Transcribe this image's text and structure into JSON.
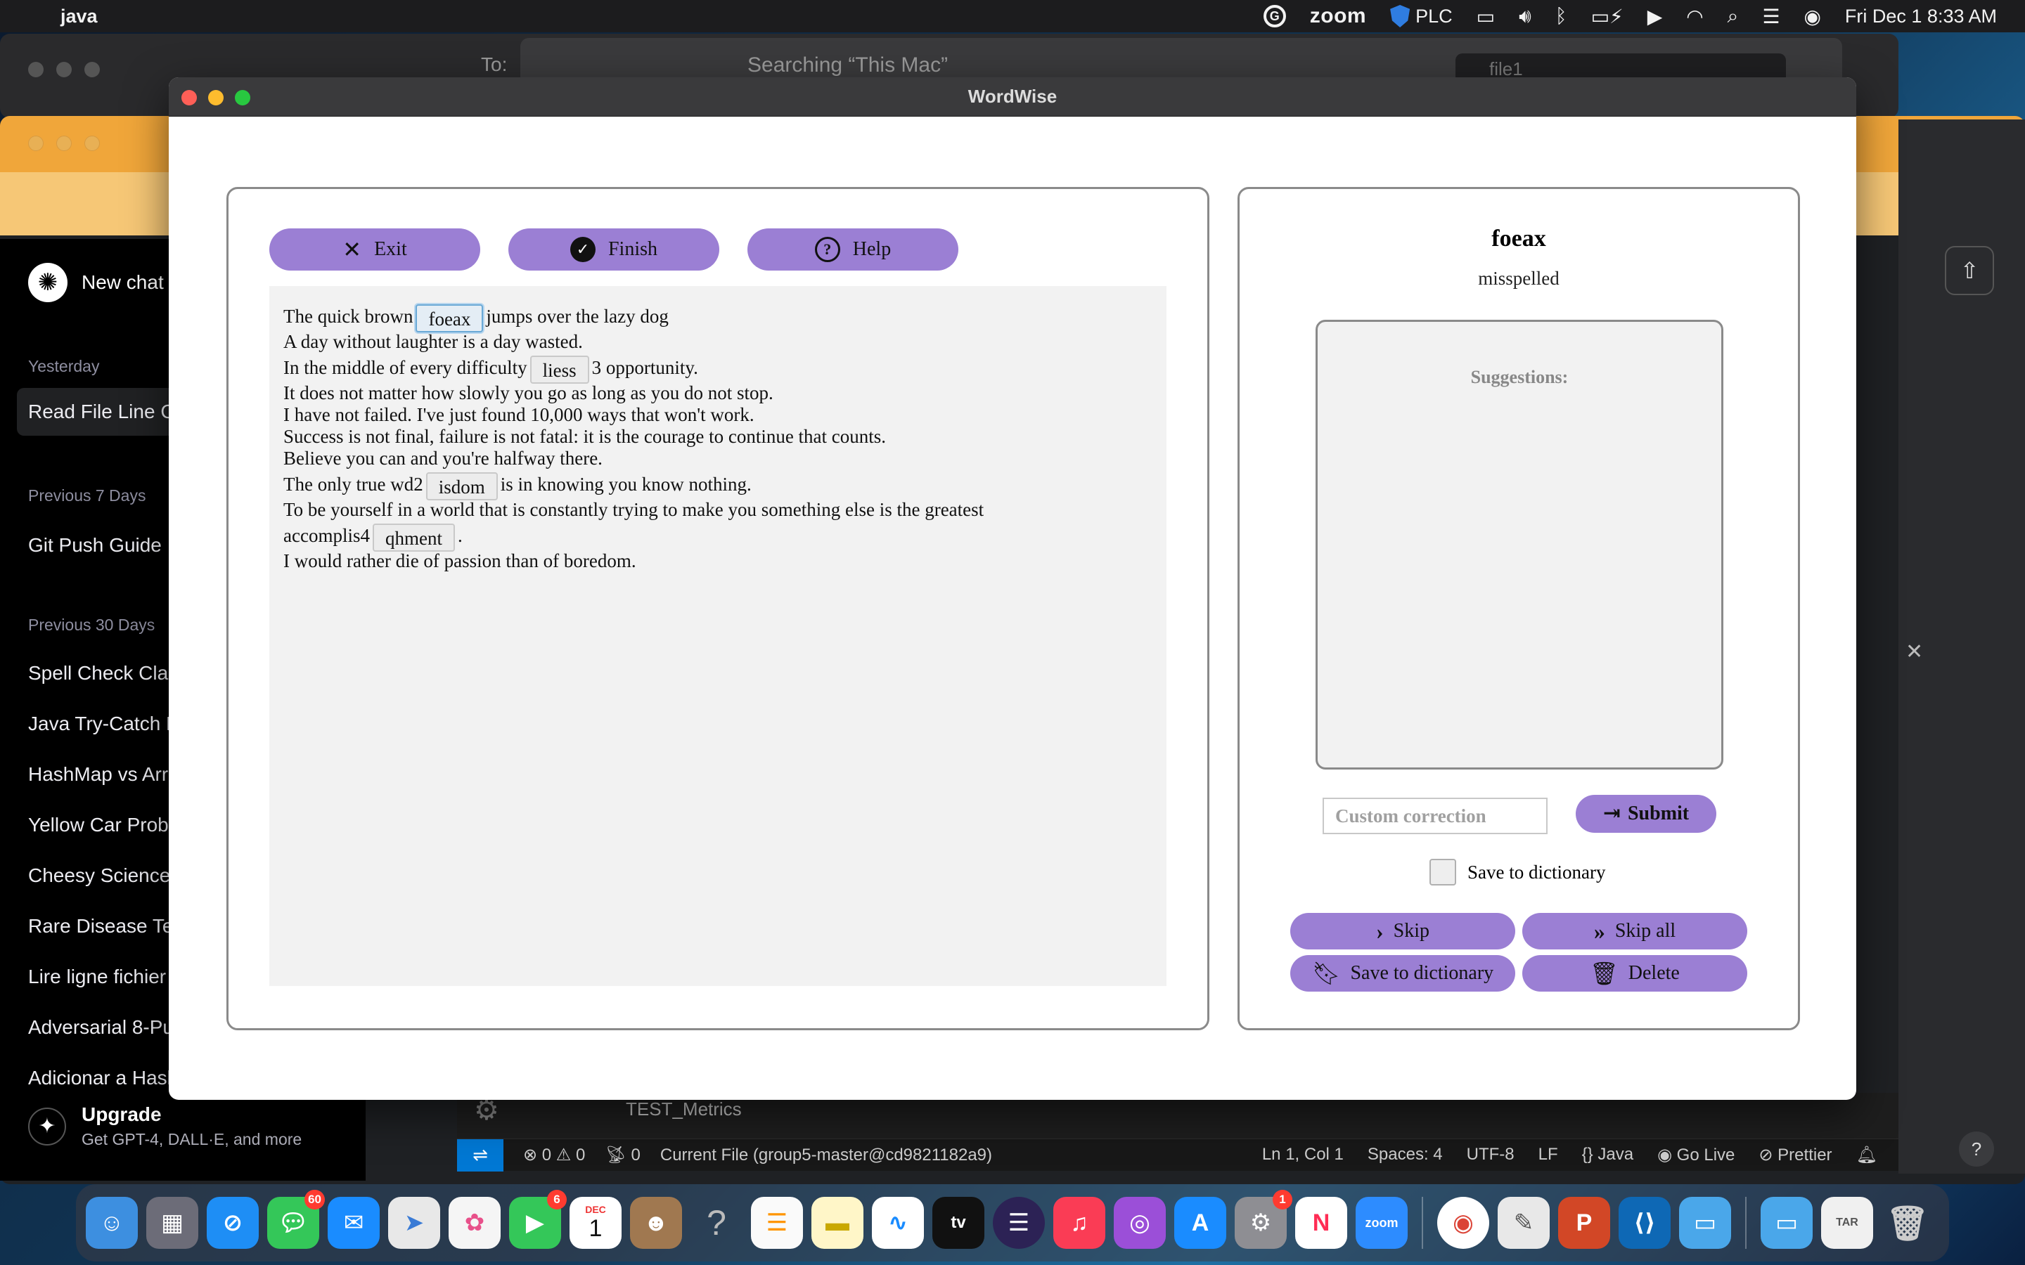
{
  "menubar": {
    "app_name": "java",
    "zoom_label": "zoom",
    "plc_label": "PLC",
    "datetime": "Fri Dec 1  8:33 AM"
  },
  "finder_bg": {
    "to_label": "To:",
    "title": "Searching “This Mac”",
    "search_value": "file1"
  },
  "chat_sidebar": {
    "new_chat": "New chat",
    "sections": [
      "Yesterday",
      "Previous 7 Days",
      "Previous 30 Days"
    ],
    "yesterday_items": [
      "Read File Line C"
    ],
    "previous7_items": [
      "Git Push Guide"
    ],
    "previous30_items": [
      "Spell Check Clas",
      "Java Try-Catch E",
      "HashMap vs Arr",
      "Yellow Car Proba",
      "Cheesy Science",
      "Rare Disease Te",
      "Lire ligne fichier",
      "Adversarial 8-Pu",
      "Adicionar a Hasl"
    ],
    "upgrade_title": "Upgrade",
    "upgrade_sub": "Get GPT-4, DALL·E, and more"
  },
  "vscode": {
    "explorer_file": "TEST_Metrics",
    "status": {
      "errors": "0",
      "warnings": "0",
      "ports": "0",
      "current_file": "Current File (group5-master@cd9821182a9)",
      "position": "Ln 1, Col 1",
      "spaces": "Spaces: 4",
      "encoding": "UTF-8",
      "eol": "LF",
      "language": "Java",
      "golive": "Go Live",
      "prettier": "Prettier"
    }
  },
  "wordwise": {
    "window_title": "WordWise",
    "buttons": {
      "exit": "Exit",
      "finish": "Finish",
      "help": "Help"
    },
    "text_lines": {
      "l1_pre": "The quick brown",
      "l1_chip": "foeax",
      "l1_post": "jumps over the lazy dog",
      "l2": "A day without laughter is a day wasted.",
      "l3_pre": "In the middle of every difficulty",
      "l3_chip": "liess",
      "l3_post": "3 opportunity.",
      "l4": "It does not matter how slowly you go as long as you do not stop.",
      "l5": "I have not failed. I've just found 10,000 ways that won't work.",
      "l6": "Success is not final, failure is not fatal: it is the courage to continue that counts.",
      "l7": "Believe you can and you're halfway there.",
      "l8_pre": "The only true wd2",
      "l8_chip": "isdom",
      "l8_post": "is in knowing you know nothing.",
      "l9": "To be yourself in a world that is constantly trying to make you something else is the greatest",
      "l10_pre": "accomplis4",
      "l10_chip": "qhment",
      "l10_post": ".",
      "l11": "I would rather die of passion than of boredom."
    },
    "side": {
      "word": "foeax",
      "status": "misspelled",
      "suggestions_label": "Suggestions:",
      "custom_placeholder": "Custom correction",
      "submit": "Submit",
      "save_checkbox_label": "Save to dictionary",
      "skip": "Skip",
      "skip_all": "Skip all",
      "save_to_dictionary": "Save to dictionary",
      "delete": "Delete"
    }
  },
  "dock": {
    "badges": {
      "messages": "60",
      "facetime": "6",
      "settings": "1"
    },
    "calendar_month": "DEC",
    "calendar_day": "1",
    "zoom_label": "zoom"
  },
  "colors": {
    "accent_purple": "#9b7fd4",
    "panel_border": "#8a8a8a",
    "text_area_bg": "#f2f2f2"
  }
}
